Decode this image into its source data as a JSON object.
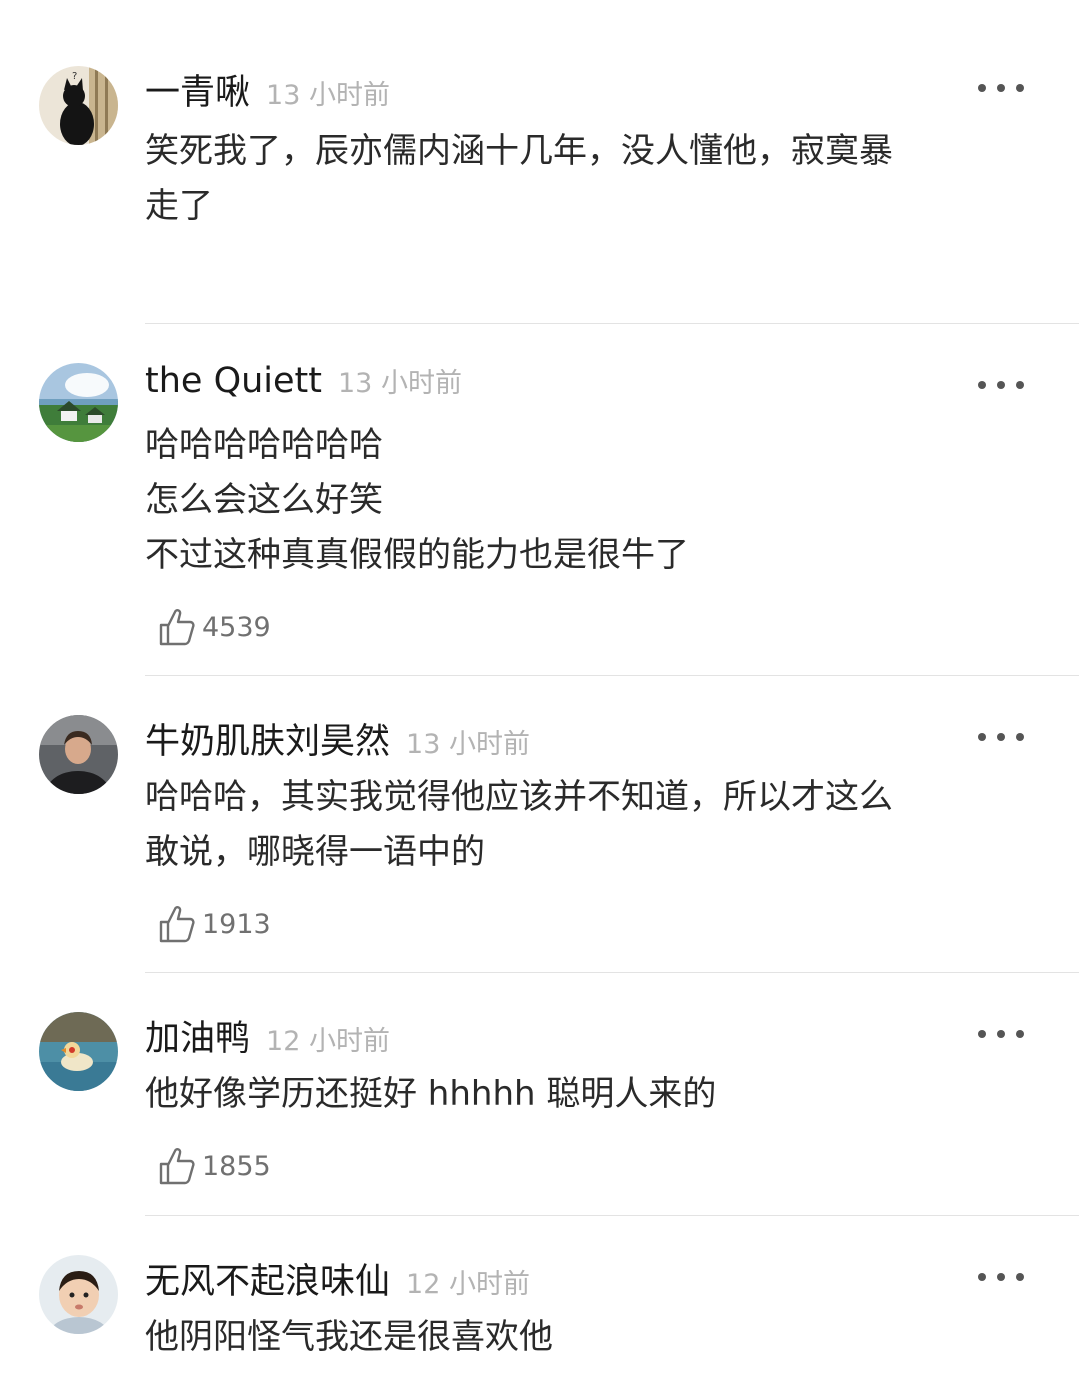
{
  "comments": [
    {
      "username": "一青啾",
      "time": "13 小时前",
      "lines": [
        "笑死我了，辰亦儒内涵十几年，没人懂他，寂寞暴",
        "走了"
      ],
      "likes": null,
      "avatar_icon": "black-cat-avatar"
    },
    {
      "username": "the Quiett",
      "time": "13 小时前",
      "lines": [
        "哈哈哈哈哈哈哈",
        "怎么会这么好笑",
        "不过这种真真假假的能力也是很牛了"
      ],
      "likes": "4539",
      "avatar_icon": "landscape-avatar"
    },
    {
      "username": "牛奶肌肤刘昊然",
      "time": "13 小时前",
      "lines": [
        "哈哈哈，其实我觉得他应该并不知道，所以才这么",
        "敢说，哪晓得一语中的"
      ],
      "likes": "1913",
      "avatar_icon": "person-photo-avatar"
    },
    {
      "username": "加油鸭",
      "time": "12 小时前",
      "lines": [
        "他好像学历还挺好 hhhhh 聪明人来的"
      ],
      "likes": "1855",
      "avatar_icon": "duck-avatar"
    },
    {
      "username": "无风不起浪味仙",
      "time": "12 小时前",
      "lines": [
        "他阴阳怪气我还是很喜欢他"
      ],
      "likes": null,
      "avatar_icon": "baby-photo-avatar"
    }
  ],
  "icons": {
    "more": "more-dots-icon",
    "like": "thumbs-up-icon"
  },
  "colors": {
    "username": "#1a1a1a",
    "time": "#b3b3b3",
    "text": "#2a2a2a",
    "divider": "#e3e3e3"
  }
}
